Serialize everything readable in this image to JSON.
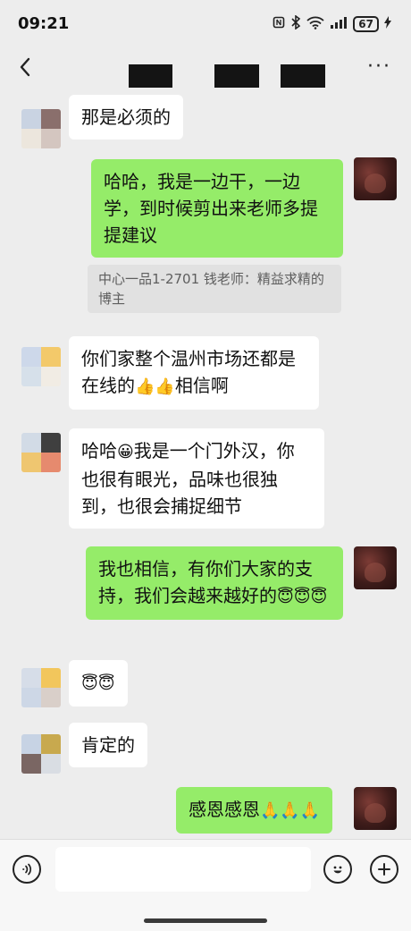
{
  "status_bar": {
    "time": "09:21",
    "battery": "67",
    "icons": [
      "nfc-icon",
      "bluetooth-icon",
      "wifi-icon",
      "signal-icon",
      "battery-icon",
      "lightning-icon"
    ]
  },
  "header": {
    "back_icon": "back-arrow-icon",
    "more_label": "···"
  },
  "messages": [
    {
      "side": "left",
      "text": "那是必须的"
    },
    {
      "side": "right",
      "text": "哈哈，我是一边干，一边学，到时候剪出来老师多提提建议"
    },
    {
      "quote": "中心一品1-2701  钱老师：精益求精的博主"
    },
    {
      "side": "left",
      "text": "你们家整个温州市场还都是在线的",
      "emoji": [
        "thumbs-up",
        "thumbs-up"
      ],
      "text_after": "相信啊"
    },
    {
      "side": "left",
      "text_before": "哈哈",
      "emoji": [
        "grinning-face"
      ],
      "text": "我是一个门外汉，你也很有眼光，品味也很独到，也很会捕捉细节"
    },
    {
      "side": "right",
      "text": "我也相信，有你们大家的支持，我们会越来越好的",
      "emoji": [
        "halo-face",
        "halo-face",
        "halo-face"
      ]
    },
    {
      "side": "left",
      "emoji": [
        "halo-face",
        "halo-face"
      ]
    },
    {
      "side": "left",
      "text": "肯定的"
    },
    {
      "side": "right",
      "text": "感恩感恩",
      "emoji": [
        "folded-hands",
        "folded-hands",
        "folded-hands"
      ]
    }
  ],
  "glyphs": {
    "thumbs-up": "👍",
    "grinning-face": "😀",
    "halo-face": "😇",
    "folded-hands": "🙏"
  },
  "input_bar": {
    "voice_icon": "voice-icon",
    "emoji_icon": "emoji-icon",
    "plus_icon": "plus-icon",
    "placeholder": ""
  },
  "colors": {
    "background": "#ededed",
    "bubble_sent": "#95ec69",
    "bubble_received": "#ffffff",
    "quote_bg": "#e1e1e1"
  }
}
